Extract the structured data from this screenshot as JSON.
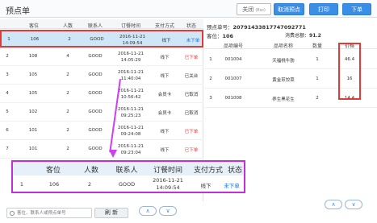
{
  "header": {
    "title": "预点单",
    "close_label": "关闭",
    "close_hint": "(Esc)",
    "cancel_label": "取消预点",
    "print_label": "打印",
    "order_label": "下单"
  },
  "list": {
    "columns": [
      "客位",
      "人数",
      "联系人",
      "订餐时间",
      "支付方式",
      "状态"
    ],
    "rows": [
      {
        "idx": "1",
        "seat": "106",
        "people": "2",
        "contact": "GOOD",
        "date": "2016-11-21",
        "time": "14:09:54",
        "pay": "线下",
        "status": "未下单",
        "status_color": "blue"
      },
      {
        "idx": "2",
        "seat": "108",
        "people": "4",
        "contact": "GOOD",
        "date": "2016-11-21",
        "time": "14:05:29",
        "pay": "线下",
        "status": "已下单",
        "status_color": "red"
      },
      {
        "idx": "3",
        "seat": "105",
        "people": "2",
        "contact": "GOOD",
        "date": "2016-11-21",
        "time": "11:40:04",
        "pay": "线下",
        "status": "已关台",
        "status_color": "black"
      },
      {
        "idx": "4",
        "seat": "105",
        "people": "2",
        "contact": "GOOD",
        "date": "2016-11-21",
        "time": "10:56:42",
        "pay": "会员卡",
        "status": "已取消",
        "status_color": "black"
      },
      {
        "idx": "5",
        "seat": "102",
        "people": "2",
        "contact": "GOOD",
        "date": "2016-11-21",
        "time": "09:25:23",
        "pay": "会员卡",
        "status": "已取消",
        "status_color": "black"
      },
      {
        "idx": "6",
        "seat": "101",
        "people": "2",
        "contact": "GOOD",
        "date": "2016-11-21",
        "time": "09:24:08",
        "pay": "线下",
        "status": "已下单",
        "status_color": "red"
      },
      {
        "idx": "7",
        "seat": "101",
        "people": "2",
        "contact": "GOOD",
        "date": "2016-11-21",
        "time": "09:23:04",
        "pay": "线下",
        "status": "已下单",
        "status_color": "red"
      }
    ]
  },
  "detail": {
    "order_label": "预点单号：",
    "order_no": "20791433817747092771",
    "seat_label": "客位：",
    "seat_value": "106",
    "total_label": "消费总额：",
    "total_value": "91.2",
    "columns": [
      "品项编号",
      "品项名称",
      "数量",
      "价格"
    ],
    "items": [
      {
        "idx": "1",
        "code": "001004",
        "name": "天福桃牛肪",
        "qty": "1",
        "price": "46.4"
      },
      {
        "idx": "2",
        "code": "001007",
        "name": "黄金煎饺菜",
        "qty": "1",
        "price": "16"
      },
      {
        "idx": "3",
        "code": "001008",
        "name": "养生黑花生",
        "qty": "2",
        "price": "14.4"
      }
    ]
  },
  "zoom": {
    "columns": [
      "客位",
      "人数",
      "联系人",
      "订餐时间",
      "支付方式",
      "状态"
    ],
    "row": {
      "idx": "1",
      "seat": "106",
      "people": "2",
      "contact": "GOOD",
      "date": "2016-11-21",
      "time": "14:09:54",
      "pay": "线下",
      "status": "未下单"
    }
  },
  "footer": {
    "search_placeholder": "客位、联系人或预点单号",
    "refresh_label": "刷 新",
    "pager_up": "∧",
    "pager_down": "∨"
  },
  "colors": {
    "accent": "#3a8ee6",
    "highlight_red": "#e53935",
    "callout_magenta": "#c22fd6",
    "selected_row": "#cfe6f7"
  }
}
